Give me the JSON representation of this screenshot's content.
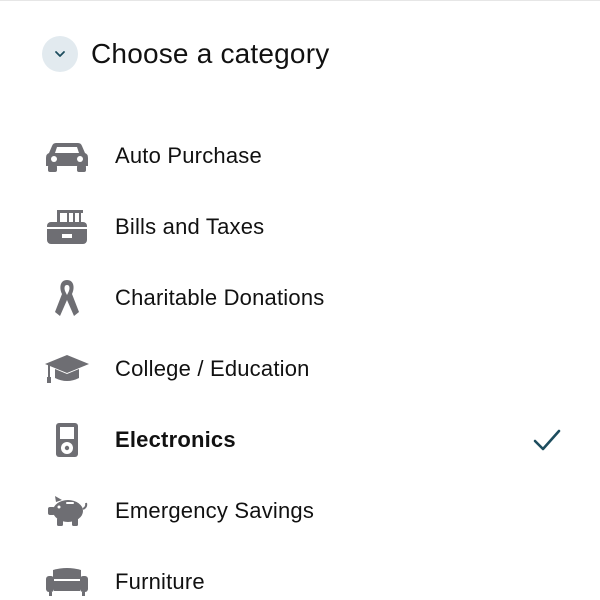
{
  "header": {
    "title": "Choose a category",
    "collapse_icon": "chevron-down-icon"
  },
  "colors": {
    "accent": "#1d4d5e",
    "icon_gray": "#6e6e73",
    "chevron_bg": "#e2eaef"
  },
  "categories": [
    {
      "label": "Auto Purchase",
      "icon": "car-icon",
      "selected": false
    },
    {
      "label": "Bills and Taxes",
      "icon": "cash-register-icon",
      "selected": false
    },
    {
      "label": "Charitable Donations",
      "icon": "ribbon-icon",
      "selected": false
    },
    {
      "label": "College / Education",
      "icon": "graduation-cap-icon",
      "selected": false
    },
    {
      "label": "Electronics",
      "icon": "music-player-icon",
      "selected": true
    },
    {
      "label": "Emergency Savings",
      "icon": "piggy-bank-icon",
      "selected": false
    },
    {
      "label": "Furniture",
      "icon": "sofa-icon",
      "selected": false
    }
  ]
}
